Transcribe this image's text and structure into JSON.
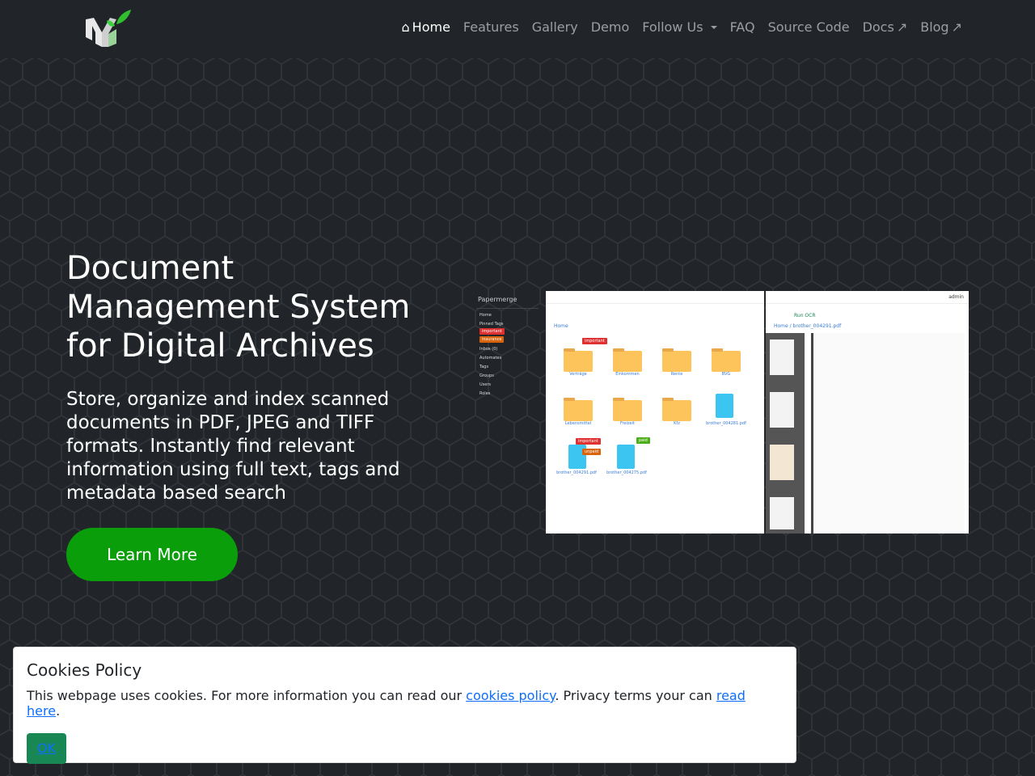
{
  "nav": {
    "items": [
      {
        "label": "Home",
        "icon": "house-icon",
        "active": true
      },
      {
        "label": "Features"
      },
      {
        "label": "Gallery"
      },
      {
        "label": "Demo"
      },
      {
        "label": "Follow Us",
        "dropdown": true
      },
      {
        "label": "FAQ"
      },
      {
        "label": "Source Code"
      },
      {
        "label": "Docs",
        "icon": "external-link-icon"
      },
      {
        "label": "Blog",
        "icon": "external-link-icon"
      }
    ]
  },
  "hero": {
    "title": "Document Management System for Digital Archives",
    "subtitle": "Store, organize and index scanned documents in PDF, JPEG and TIFF formats. Instantly find relevant information using full text, tags and metadata based search",
    "button": "Learn More"
  },
  "screenshot": {
    "brand": "Papermerge",
    "sidebar": [
      "Home",
      "Pinned Tags",
      "Inbox (0)",
      "Automates",
      "Tags",
      "Groups",
      "Users",
      "Roles"
    ],
    "pinned_tags": [
      "important",
      "insurance"
    ],
    "breadcrumb": "Home",
    "folders": [
      "Verträge",
      "Einkommen",
      "Rente",
      "BVG",
      "Lebensmittel",
      "Freizeit",
      "Kfz"
    ],
    "files": [
      "brother_004281.pdf",
      "brother_004291.pdf",
      "brother_004275.pdf"
    ],
    "tags": [
      "important",
      "important",
      "unpaid",
      "paid"
    ],
    "user": "admin",
    "run_ocr": "Run OCR",
    "viewer_breadcrumb": "Home / brother_004291.pdf"
  },
  "cookie": {
    "title": "Cookies Policy",
    "text_before": "This webpage uses cookies. For more information you can read our ",
    "link1": "cookies policy",
    "text_middle": ". Privacy terms your can ",
    "link2": "read here",
    "text_after": ".",
    "ok": "OK"
  },
  "colors": {
    "background": "#212529",
    "accent": "#0a9e0a",
    "ok_button": "#198754",
    "link": "#0d6efd"
  }
}
